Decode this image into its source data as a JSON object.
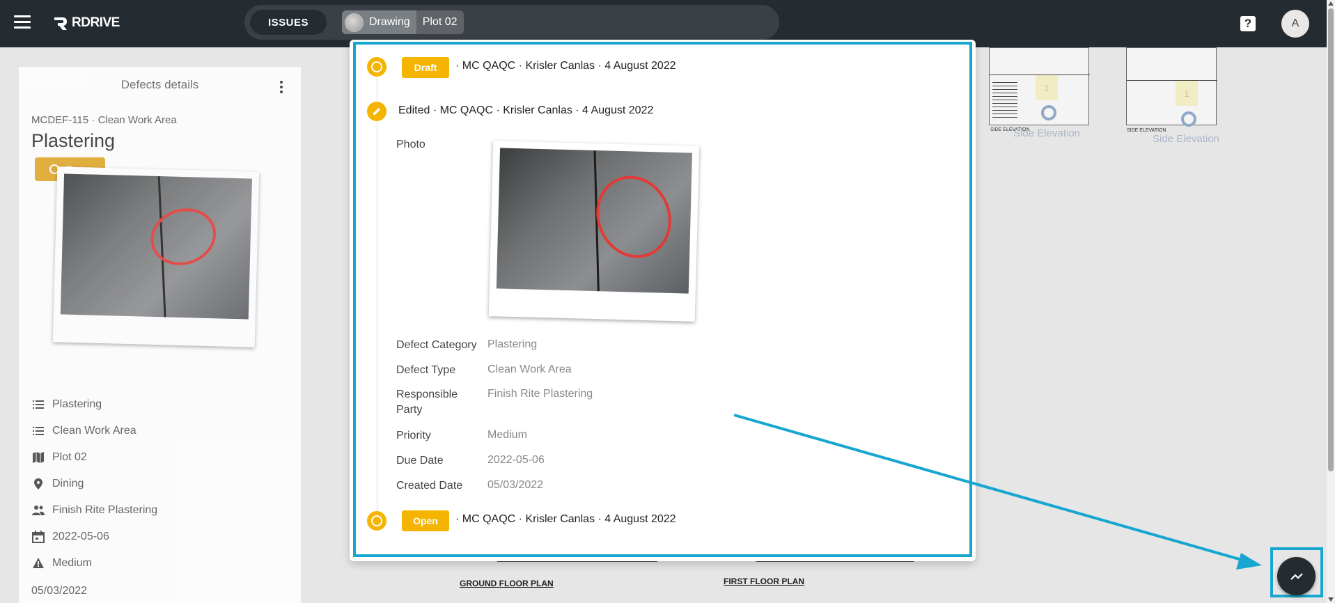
{
  "app": {
    "name": "RDRIVE"
  },
  "topbar": {
    "issues_label": "ISSUES",
    "drawing_label": "Drawing",
    "plot_label": "Plot 02",
    "help_label": "?",
    "avatar_initial": "A"
  },
  "left_panel": {
    "title": "Defects details",
    "ref": "MCDEF-115 · Clean Work Area",
    "defect_title": "Plastering",
    "status": "Open",
    "attributes": [
      {
        "icon": "list-icon",
        "label": "Plastering"
      },
      {
        "icon": "list-icon",
        "label": "Clean Work Area"
      },
      {
        "icon": "map-icon",
        "label": "Plot 02"
      },
      {
        "icon": "location-pin-icon",
        "label": "Dining"
      },
      {
        "icon": "people-icon",
        "label": "Finish Rite Plastering"
      },
      {
        "icon": "calendar-icon",
        "label": "2022-05-06"
      },
      {
        "icon": "warning-icon",
        "label": "Medium"
      }
    ],
    "created": "05/03/2022"
  },
  "background_drawing": {
    "elevation_label_1": "Side Elevation",
    "elevation_label_2": "Side Elevation",
    "elevation_small_1": "SIDE ELEVATION",
    "elevation_small_2": "SIDE ELEVATION",
    "marker_number_1": "1",
    "marker_number_2": "1",
    "plan_label_1": "GROUND FLOOR PLAN",
    "plan_label_2": "FIRST FLOOR PLAN"
  },
  "modal": {
    "entries": [
      {
        "status": "Draft",
        "meta": "· MC QAQC · Krisler Canlas · 4 August 2022"
      },
      {
        "meta": "Edited · MC QAQC · Krisler Canlas · 4 August 2022"
      },
      {
        "status": "Open",
        "meta": "· MC QAQC · Krisler Canlas · 4 August 2022"
      }
    ],
    "photo_label": "Photo",
    "fields": [
      {
        "label": "Defect Category",
        "value": "Plastering"
      },
      {
        "label": "Defect Type",
        "value": "Clean Work Area"
      },
      {
        "label": "Responsible Party",
        "value": "Finish Rite Plastering"
      },
      {
        "label": "Priority",
        "value": "Medium"
      },
      {
        "label": "Due Date",
        "value": "2022-05-06"
      },
      {
        "label": "Created Date",
        "value": "05/03/2022"
      }
    ]
  },
  "colors": {
    "topbar": "#252c31",
    "accent_yellow": "#f4b400",
    "open_badge": "#e1a82a",
    "highlight": "#17a6cf"
  }
}
